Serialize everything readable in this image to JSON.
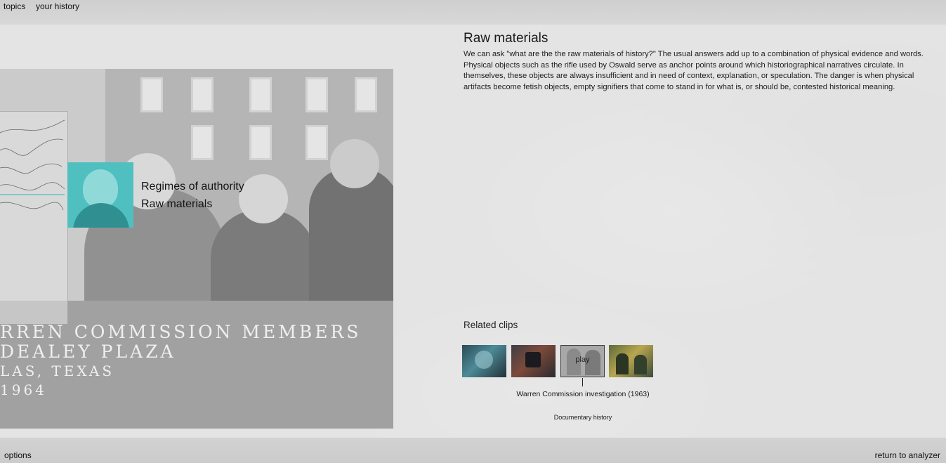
{
  "nav": {
    "topics": "topics",
    "history": "your history"
  },
  "footer": {
    "options": "options",
    "return": "return to analyzer"
  },
  "video": {
    "caption_lines": [
      "RREN COMMISSION MEMBERS",
      "DEALEY PLAZA",
      "LAS, TEXAS",
      " 1964"
    ]
  },
  "topics_panel": {
    "items": [
      "Regimes of authority",
      "Raw materials"
    ],
    "highlight_color": "#4fbfc0"
  },
  "article": {
    "title": "Raw materials",
    "body": "We can ask \"what are the the raw materials of history?\" The usual answers add up to a combination of physical evidence and words. Physical objects such as the rifle used by Oswald serve as anchor points around which historiographical narratives circulate. In themselves, these objects are always insufficient and in need of context, explanation, or speculation. The danger is when physical artifacts become fetish objects, empty signifiers that come to stand in for what is, or should be, contested historical meaning."
  },
  "related": {
    "heading": "Related clips",
    "play_label": "play",
    "selected_caption": "Warren Commission investigation (1963)",
    "category": "Documentary history"
  }
}
